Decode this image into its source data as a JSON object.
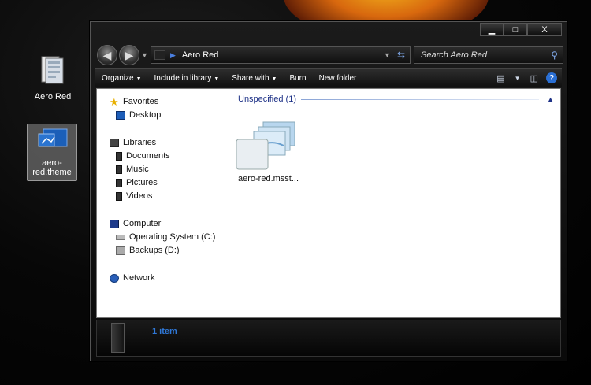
{
  "desktop": {
    "icons": [
      {
        "label": "Aero Red",
        "icon": "document-folder-icon"
      },
      {
        "label": "aero-red.theme",
        "icon": "theme-file-icon"
      }
    ]
  },
  "window": {
    "caption_buttons": {
      "minimize": "▁",
      "maximize": "□",
      "close": "X"
    },
    "address": {
      "path": "Aero Red"
    },
    "search": {
      "placeholder": "Search Aero Red"
    },
    "toolbar": {
      "organize": "Organize",
      "include_in_library": "Include in library",
      "share_with": "Share with",
      "burn": "Burn",
      "new_folder": "New folder"
    },
    "nav_pane": {
      "favorites": "Favorites",
      "desktop": "Desktop",
      "libraries": "Libraries",
      "documents": "Documents",
      "music": "Music",
      "pictures": "Pictures",
      "videos": "Videos",
      "computer": "Computer",
      "os_drive": "Operating System (C:)",
      "backups_drive": "Backups (D:)",
      "network": "Network"
    },
    "file_pane": {
      "group_header": "Unspecified (1)",
      "files": [
        {
          "name": "aero-red.msst..."
        }
      ]
    },
    "details": {
      "count": "1 item"
    }
  },
  "colors": {
    "accent": "#2f78d8",
    "group_header": "#1e3287"
  }
}
